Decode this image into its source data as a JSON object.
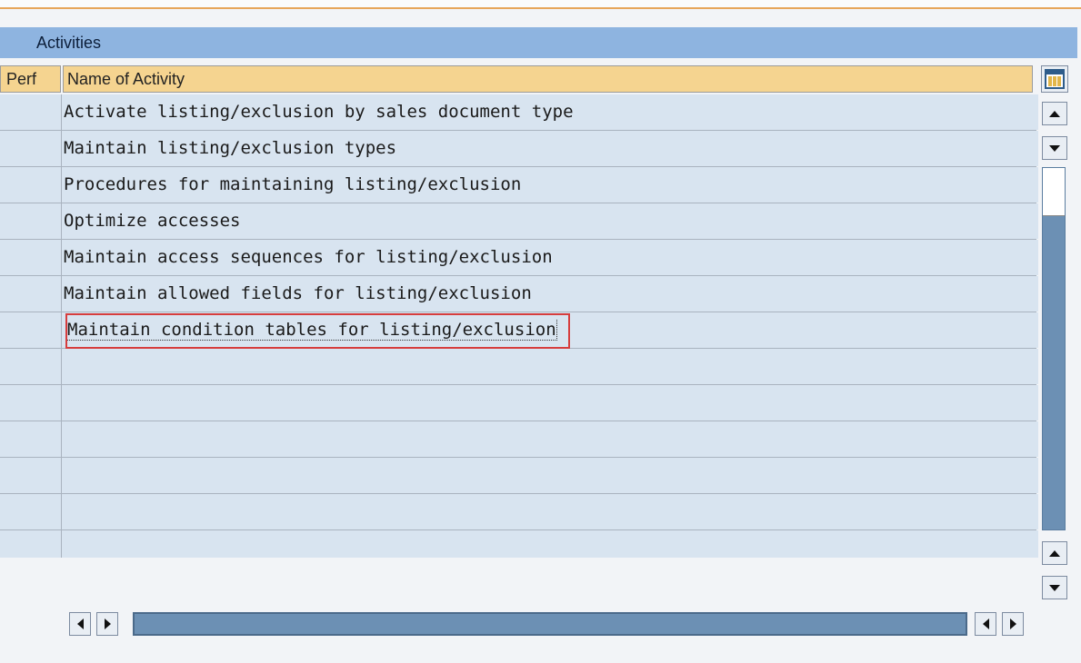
{
  "panel": {
    "title": "Activities"
  },
  "table": {
    "columns": [
      "Perf",
      "Name of Activity"
    ],
    "rows": [
      "Activate listing/exclusion by sales document type",
      "Maintain listing/exclusion types",
      "Procedures for maintaining listing/exclusion",
      "Optimize accesses",
      "Maintain access sequences for listing/exclusion",
      "Maintain allowed fields for listing/exclusion",
      "Maintain condition tables for listing/exclusion",
      "",
      "",
      "",
      "",
      "",
      ""
    ],
    "selected_row": "Maintain condition tables for listing/exclusion"
  },
  "icons": {
    "column_settings": "table-settings-icon",
    "scroll_up": "arrow-up-icon",
    "scroll_down": "arrow-down-icon",
    "scroll_left": "arrow-left-icon",
    "scroll_right": "arrow-right-icon"
  },
  "colors": {
    "title_bar": "#8eb4e0",
    "header": "#f5d490",
    "row_bg": "#d8e4f0",
    "highlight_border": "#d63d3d",
    "scroll_track": "#6c90b4"
  }
}
